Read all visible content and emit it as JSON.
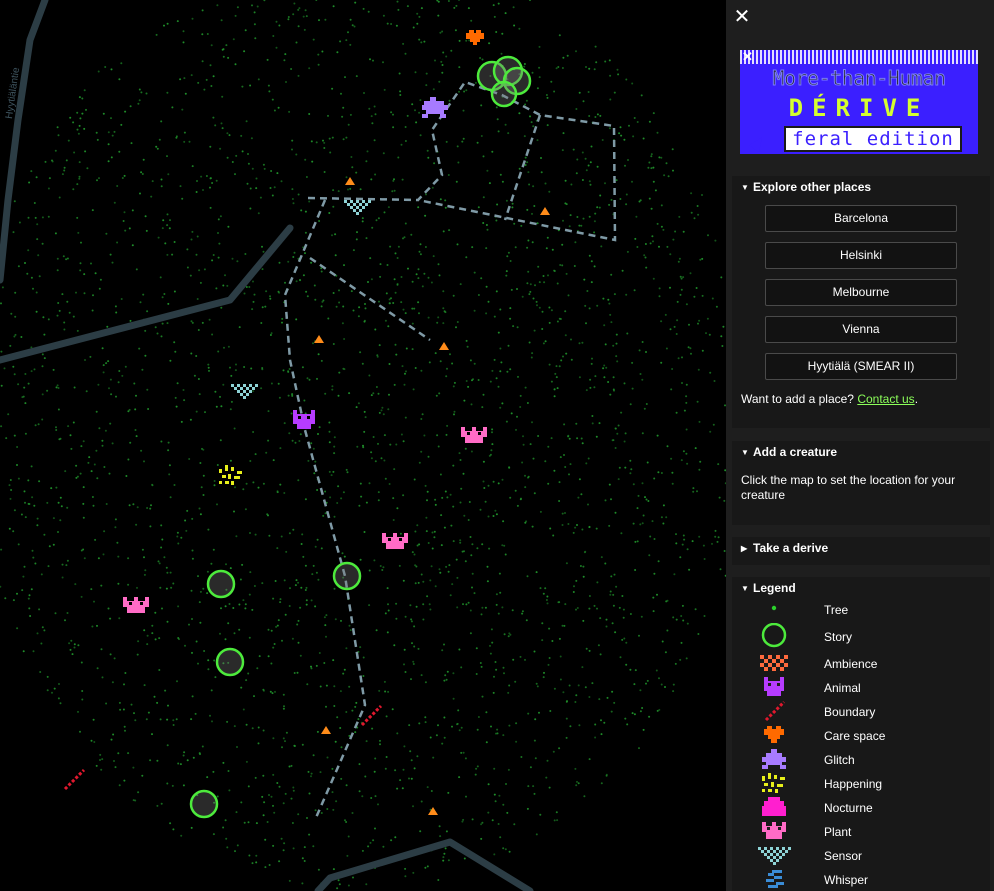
{
  "map": {
    "road_label": "Hyytiäläntie",
    "colors": {
      "background": "#000000",
      "road": "#2c3d45",
      "tree": "#1f8f2a",
      "route": "#7f9aa6"
    }
  },
  "panel": {
    "close_icon": "close-icon",
    "logo": {
      "line1": "More-than-Human",
      "line2": "DÉRIVE",
      "line3": "feral edition"
    },
    "explore": {
      "title": "Explore other places",
      "places": [
        "Barcelona",
        "Helsinki",
        "Melbourne",
        "Vienna",
        "Hyytiälä (SMEAR II)"
      ],
      "want_text": "Want to add a place?",
      "contact_link": "Contact us",
      "want_end": "."
    },
    "add_creature": {
      "title": "Add a creature",
      "text": "Click the map to set the location for your creature"
    },
    "derive": {
      "title": "Take a derive"
    },
    "legend": {
      "title": "Legend",
      "items": [
        {
          "label": "Tree",
          "icon": "tree-icon",
          "color": "#2bd12b"
        },
        {
          "label": "Story",
          "icon": "story-icon",
          "color": "#4dea3c"
        },
        {
          "label": "Ambience",
          "icon": "ambience-icon",
          "color": "#ff6a3d"
        },
        {
          "label": "Animal",
          "icon": "animal-icon",
          "color": "#b63cff"
        },
        {
          "label": "Boundary",
          "icon": "boundary-icon",
          "color": "#e0182e"
        },
        {
          "label": "Care space",
          "icon": "care-space-icon",
          "color": "#ff6a00"
        },
        {
          "label": "Glitch",
          "icon": "glitch-icon",
          "color": "#a77bff"
        },
        {
          "label": "Happening",
          "icon": "happening-icon",
          "color": "#e8f01a"
        },
        {
          "label": "Nocturne",
          "icon": "nocturne-icon",
          "color": "#ff1fcf"
        },
        {
          "label": "Plant",
          "icon": "plant-icon",
          "color": "#ff6bc6"
        },
        {
          "label": "Sensor",
          "icon": "sensor-icon",
          "color": "#8ed3d6"
        },
        {
          "label": "Whisper",
          "icon": "whisper-icon",
          "color": "#3a8cd6"
        }
      ]
    }
  }
}
